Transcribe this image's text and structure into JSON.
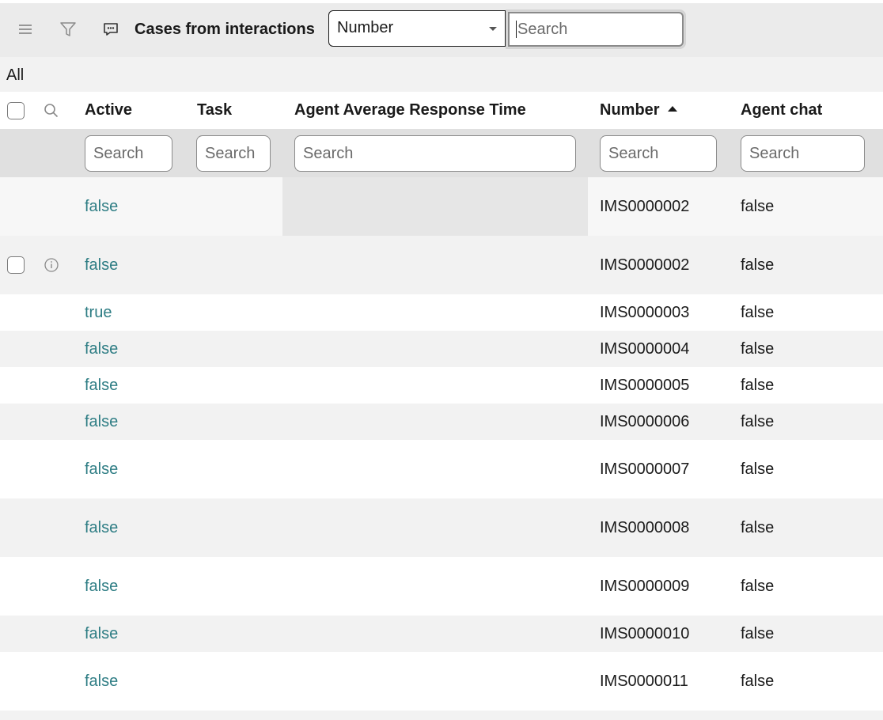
{
  "toolbar": {
    "title": "Cases from interactions",
    "field_select": "Number",
    "search_placeholder": "Search"
  },
  "breadcrumb": "All",
  "columns": [
    "Active",
    "Task",
    "Agent Average Response Time",
    "Number",
    "Agent chat"
  ],
  "sort": {
    "column": "Number",
    "direction": "ascending"
  },
  "column_search_placeholder": "Search",
  "column_filters": {
    "active": "Search",
    "task": "Search",
    "agent_avg_response_time": "Search",
    "number": "Search",
    "agent_chat": "Search"
  },
  "rows": [
    {
      "active": "false",
      "task": "",
      "agent_avg_response_time": "",
      "number": "IMS0000002",
      "agent_chat": "false"
    },
    {
      "active": "false",
      "task": "",
      "agent_avg_response_time": "",
      "number": "IMS0000002",
      "agent_chat": "false"
    },
    {
      "active": "true",
      "task": "",
      "agent_avg_response_time": "",
      "number": "IMS0000003",
      "agent_chat": "false"
    },
    {
      "active": "false",
      "task": "",
      "agent_avg_response_time": "",
      "number": "IMS0000004",
      "agent_chat": "false"
    },
    {
      "active": "false",
      "task": "",
      "agent_avg_response_time": "",
      "number": "IMS0000005",
      "agent_chat": "false"
    },
    {
      "active": "false",
      "task": "",
      "agent_avg_response_time": "",
      "number": "IMS0000006",
      "agent_chat": "false"
    },
    {
      "active": "false",
      "task": "",
      "agent_avg_response_time": "",
      "number": "IMS0000007",
      "agent_chat": "false"
    },
    {
      "active": "false",
      "task": "",
      "agent_avg_response_time": "",
      "number": "IMS0000008",
      "agent_chat": "false"
    },
    {
      "active": "false",
      "task": "",
      "agent_avg_response_time": "",
      "number": "IMS0000009",
      "agent_chat": "false"
    },
    {
      "active": "false",
      "task": "",
      "agent_avg_response_time": "",
      "number": "IMS0000010",
      "agent_chat": "false"
    },
    {
      "active": "false",
      "task": "",
      "agent_avg_response_time": "",
      "number": "IMS0000011",
      "agent_chat": "false"
    }
  ],
  "icons": [
    "hamburger-menu-icon",
    "filter-funnel-icon",
    "chat-bubble-icon",
    "search-icon",
    "info-icon",
    "sort-ascending-icon"
  ],
  "colors": {
    "toolbar_bg": "#ebebeb",
    "filter_row_bg": "#e0e0e0",
    "link": "#2e7d84",
    "stripe": "#f2f2f2"
  }
}
